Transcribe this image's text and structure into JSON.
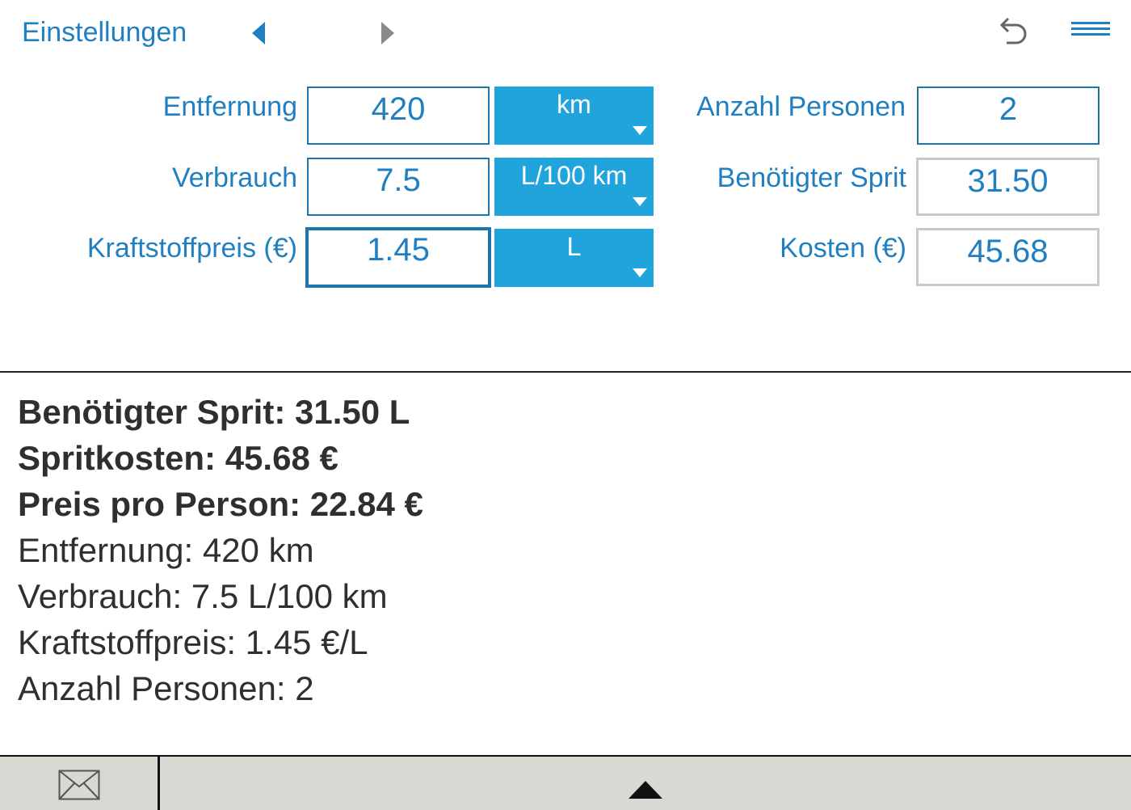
{
  "header": {
    "settings_label": "Einstellungen",
    "icons": {
      "prev": "triangle-left-icon",
      "next": "triangle-right-icon",
      "undo": "undo-arrow-icon",
      "menu": "hamburger-menu-icon"
    }
  },
  "form": {
    "distance": {
      "label": "Entfernung",
      "value": "420",
      "unit": "km"
    },
    "consumption": {
      "label": "Verbrauch",
      "value": "7.5",
      "unit": "L/100 km"
    },
    "fuel_price": {
      "label": "Kraftstoffpreis (€)",
      "value": "1.45",
      "unit": "L"
    },
    "persons": {
      "label": "Anzahl Personen",
      "value": "2"
    },
    "fuel_needed": {
      "label": "Benötigter Sprit",
      "value": "31.50"
    },
    "costs": {
      "label": "Kosten (€)",
      "value": "45.68"
    }
  },
  "results": {
    "fuel_needed": "Benötigter Sprit: 31.50 L",
    "fuel_costs": "Spritkosten: 45.68 €",
    "price_per_person": "Preis pro Person: 22.84 €",
    "distance": "Entfernung: 420 km",
    "consumption": "Verbrauch: 7.5 L/100 km",
    "fuel_price": "Kraftstoffpreis: 1.45 €/L",
    "persons": "Anzahl Personen: 2"
  },
  "footer": {
    "icons": {
      "mail": "envelope-icon",
      "expand": "triangle-up-icon"
    }
  },
  "colors": {
    "accent": "#1f7fc0",
    "select_background": "#21a3dc",
    "field_border": "#1d76b0",
    "readonly_border": "#c8c8c8",
    "bottom_bar": "#d9d8d3"
  }
}
